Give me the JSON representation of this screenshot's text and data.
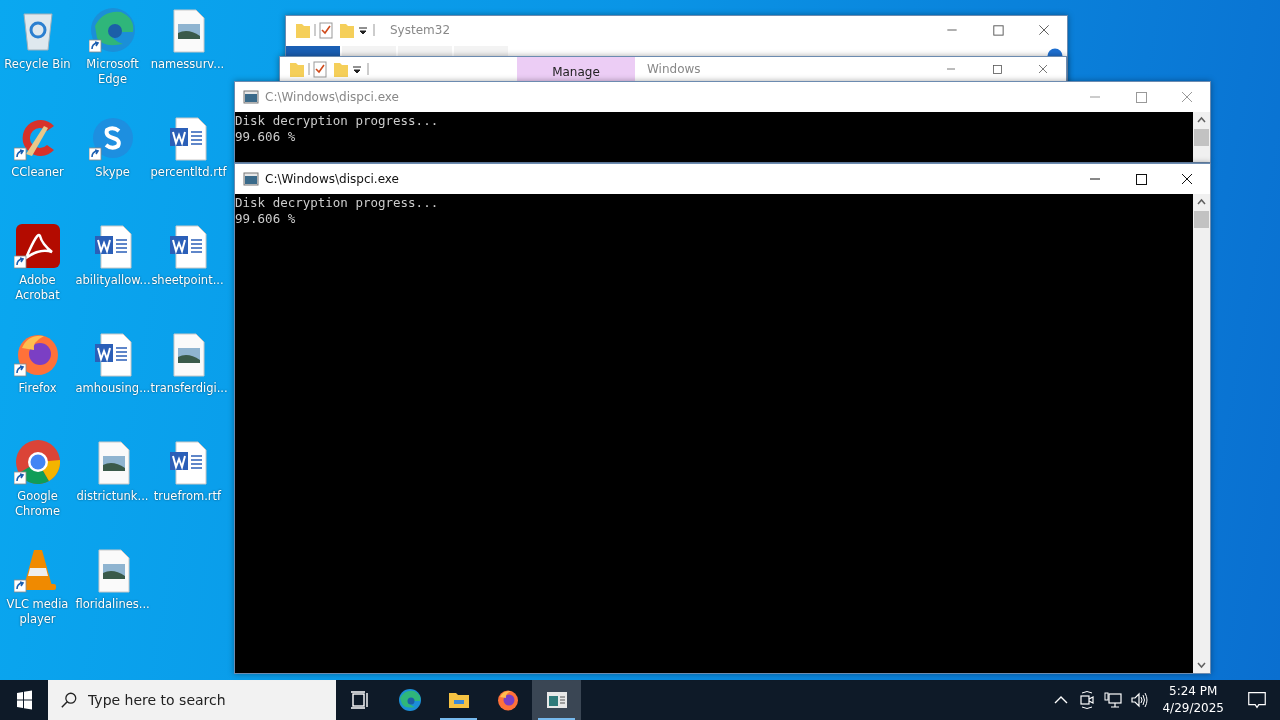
{
  "desktop_icons": [
    {
      "label": "Recycle Bin",
      "kind": "recycle",
      "shortcut": false
    },
    {
      "label": "CCleaner",
      "kind": "ccleaner",
      "shortcut": true
    },
    {
      "label": "Adobe Acrobat",
      "kind": "acrobat",
      "shortcut": true
    },
    {
      "label": "Firefox",
      "kind": "firefox",
      "shortcut": true
    },
    {
      "label": "Google Chrome",
      "kind": "chrome",
      "shortcut": true
    },
    {
      "label": "VLC media player",
      "kind": "vlc",
      "shortcut": true
    },
    {
      "label": "Microsoft Edge",
      "kind": "edge",
      "shortcut": true
    },
    {
      "label": "Skype",
      "kind": "skype",
      "shortcut": true
    },
    {
      "label": "abilityallow...",
      "kind": "word",
      "shortcut": false
    },
    {
      "label": "amhousing...",
      "kind": "word",
      "shortcut": false
    },
    {
      "label": "districtunk...",
      "kind": "image",
      "shortcut": false
    },
    {
      "label": "floridalines...",
      "kind": "image",
      "shortcut": false
    },
    {
      "label": "namessurv...",
      "kind": "image",
      "shortcut": false
    },
    {
      "label": "percentltd.rtf",
      "kind": "word",
      "shortcut": false
    },
    {
      "label": "sheetpoint...",
      "kind": "word",
      "shortcut": false
    },
    {
      "label": "transferdigi...",
      "kind": "image",
      "shortcut": false
    },
    {
      "label": "truefrom.rtf",
      "kind": "word",
      "shortcut": false
    }
  ],
  "windows": [
    {
      "kind": "explorer",
      "title": "System32",
      "active": false,
      "ribbon_tabs": [
        {
          "selected": true
        },
        {
          "selected": false
        },
        {
          "selected": false
        },
        {
          "selected": false
        }
      ]
    },
    {
      "kind": "explorer",
      "title": "Windows",
      "active": false,
      "context_tab": "Manage"
    },
    {
      "kind": "console",
      "title": "C:\\Windows\\dispci.exe",
      "active": false,
      "lines": [
        "Disk decryption progress...",
        "99.606 %"
      ]
    },
    {
      "kind": "console",
      "title": "C:\\Windows\\dispci.exe",
      "active": true,
      "lines": [
        "Disk decryption progress...",
        "99.606 %"
      ]
    }
  ],
  "taskbar": {
    "search": {
      "placeholder": "Type here to search"
    },
    "apps": [
      {
        "kind": "task-view",
        "running": false,
        "selected": false
      },
      {
        "kind": "edge",
        "running": false,
        "selected": false
      },
      {
        "kind": "explorer",
        "running": true,
        "selected": false
      },
      {
        "kind": "firefox",
        "running": false,
        "selected": false
      },
      {
        "kind": "console",
        "running": true,
        "selected": true
      }
    ],
    "time": "5:24 PM",
    "date": "4/29/2025"
  }
}
